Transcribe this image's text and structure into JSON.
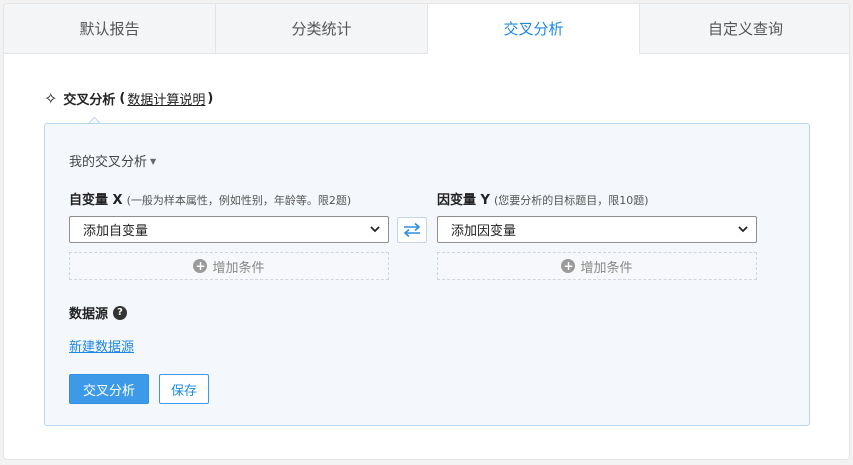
{
  "tabs": [
    {
      "label": "默认报告"
    },
    {
      "label": "分类统计"
    },
    {
      "label": "交叉分析"
    },
    {
      "label": "自定义查询"
    }
  ],
  "header": {
    "title": "交叉分析",
    "paren_open": "(",
    "help_link": "数据计算说明",
    "paren_close": ")"
  },
  "panel": {
    "my_analysis": "我的交叉分析",
    "x": {
      "label": "自变量 X",
      "hint": "(一般为样本属性，例如性别，年龄等。限2题)",
      "select_value": "添加自变量",
      "add_condition": "增加条件"
    },
    "y": {
      "label": "因变量 Y",
      "hint": "(您要分析的目标题目，限10题)",
      "select_value": "添加因变量",
      "add_condition": "增加条件"
    },
    "datasource": {
      "label": "数据源",
      "new_link": "新建数据源"
    },
    "buttons": {
      "analyze": "交叉分析",
      "save": "保存"
    }
  },
  "colors": {
    "accent": "#1e88e5",
    "panel_bg": "#f4f7fb",
    "panel_border": "#b9d6ef"
  },
  "icons": [
    "sparkle-icon",
    "caret-down-icon",
    "chevron-down-icon",
    "swap-arrows-icon",
    "plus-circle-icon",
    "question-circle-icon"
  ]
}
